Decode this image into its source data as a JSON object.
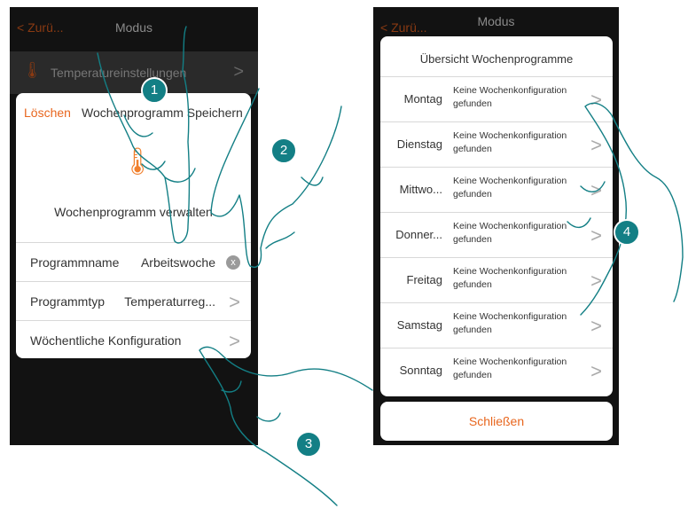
{
  "left": {
    "nav": {
      "back": "< Zurü...",
      "title": "Modus"
    },
    "settings": {
      "label": "Temperatureinstellungen",
      "chevron": ">"
    },
    "dialog": {
      "delete": "Löschen",
      "save": "Wochenprogramm Speichern",
      "save_right": "ern",
      "manage": "Wochenprogramm verwalten",
      "rows": [
        {
          "label": "Programmname",
          "value": "Arbeitswoche",
          "control": "clear-icon"
        },
        {
          "label": "Programmtyp",
          "value": "Temperaturreg...",
          "control": "chevron-right-icon"
        },
        {
          "label": "Wöchentliche Konfiguration",
          "value": "",
          "control": "chevron-right-icon"
        }
      ]
    }
  },
  "right": {
    "nav": {
      "back": "< Zurü...",
      "title": "Modus"
    },
    "title": "Übersicht Wochenprogramme",
    "days": [
      {
        "day": "Montag",
        "msg": "Keine Wochenkonfiguration gefunden"
      },
      {
        "day": "Dienstag",
        "msg": "Keine Wochenkonfiguration gefunden"
      },
      {
        "day": "Mittwo...",
        "msg": "Keine Wochenkonfiguration gefunden"
      },
      {
        "day": "Donner...",
        "msg": "Keine Wochenkonfiguration gefunden"
      },
      {
        "day": "Freitag",
        "msg": "Keine Wochenkonfiguration gefunden"
      },
      {
        "day": "Samstag",
        "msg": "Keine Wochenkonfiguration gefunden"
      },
      {
        "day": "Sonntag",
        "msg": "Keine Wochenkonfiguration gefunden"
      }
    ],
    "close": "Schließen"
  },
  "steps": [
    "1",
    "2",
    "3",
    "4"
  ],
  "colors": {
    "accent": "#e8661e",
    "step_badge": "#137f85",
    "hand_outline": "#137f85"
  }
}
